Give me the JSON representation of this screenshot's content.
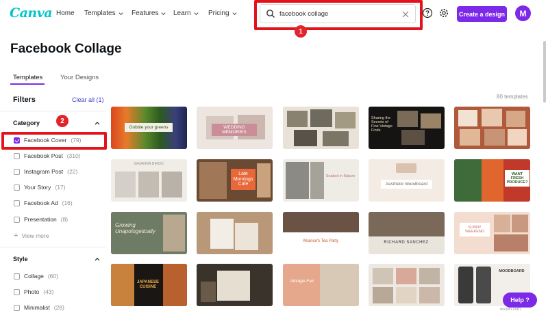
{
  "nav": {
    "logo": "Canva",
    "items": [
      "Home",
      "Templates",
      "Features",
      "Learn",
      "Pricing"
    ],
    "search_value": "facebook collage",
    "create_label": "Create a design",
    "avatar_initial": "M"
  },
  "annotations": {
    "badge1": "1",
    "badge2": "2"
  },
  "page": {
    "title": "Facebook Collage"
  },
  "tabs": [
    "Templates",
    "Your Designs"
  ],
  "filters": {
    "title": "Filters",
    "clear_all": "Clear all (1)",
    "category": {
      "title": "Category",
      "items": [
        {
          "label": "Facebook Cover",
          "count": "(79)",
          "checked": true
        },
        {
          "label": "Facebook Post",
          "count": "(310)",
          "checked": false
        },
        {
          "label": "Instagram Post",
          "count": "(22)",
          "checked": false
        },
        {
          "label": "Your Story",
          "count": "(17)",
          "checked": false
        },
        {
          "label": "Facebook Ad",
          "count": "(16)",
          "checked": false
        },
        {
          "label": "Presentation",
          "count": "(8)",
          "checked": false
        }
      ],
      "view_more": "View more"
    },
    "style": {
      "title": "Style",
      "items": [
        {
          "label": "Collage",
          "count": "(60)",
          "checked": false
        },
        {
          "label": "Photo",
          "count": "(43)",
          "checked": false
        },
        {
          "label": "Minimalist",
          "count": "(28)",
          "checked": false
        }
      ]
    }
  },
  "results": {
    "count_label": "80 templates",
    "tile_texts": [
      "Gobble your greens",
      "WEDDING MEMORIES",
      "",
      "Sharing the Secrets of Fine Vintage Finds",
      "",
      "SAVANNA BIRDS",
      "Late Mornings Cafe",
      "Soaked in Nature",
      "Aesthetic Moodboard",
      "WANT FRESH PRODUCE?",
      "Growing Unapologetically",
      "",
      "Alliance's Tea Party",
      "RICHARD SANCHEZ",
      "SUNNY WEEKEND",
      "JAPANESE CUISINE",
      "",
      "Vintage Fair",
      "",
      "MOODBOARD"
    ]
  },
  "help_label": "Help ?",
  "watermark": "wsxdn.com",
  "colors": {
    "brand": "#7d2ae8",
    "logo": "#00c4cc",
    "highlight": "#e3121b",
    "link": "#3b40c4"
  }
}
